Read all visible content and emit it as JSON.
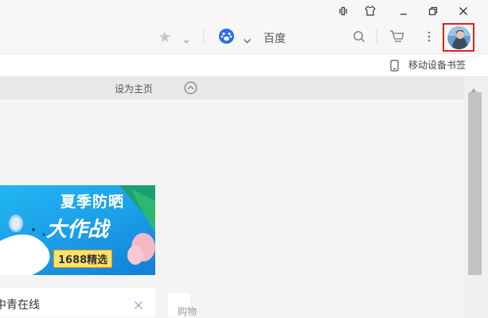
{
  "toolbar": {
    "search_engine_name": "百度",
    "icons": [
      "star-icon",
      "dropdown-icon",
      "baidu-paw-icon",
      "chevron-down-icon",
      "search-icon",
      "cart-icon",
      "more-icon",
      "avatar"
    ]
  },
  "titlebar": {
    "icons": [
      "sidebar-toggle-icon",
      "skin-icon",
      "minimize-icon",
      "restore-icon",
      "close-icon"
    ]
  },
  "bookmark_bar": {
    "mobile_bookmarks_label": "移动设备书签"
  },
  "page": {
    "set_homepage_label": "设为主页"
  },
  "banner": {
    "line1": "夏季防晒",
    "line2": "大作战",
    "tag": "1688精选"
  },
  "news_card": {
    "title": "中青在线"
  },
  "side_card": {
    "label": "购物"
  },
  "colors": {
    "highlight_border": "#e0201a",
    "baidu_blue": "#2b6de5",
    "banner_blue": "#1c9fe8"
  }
}
